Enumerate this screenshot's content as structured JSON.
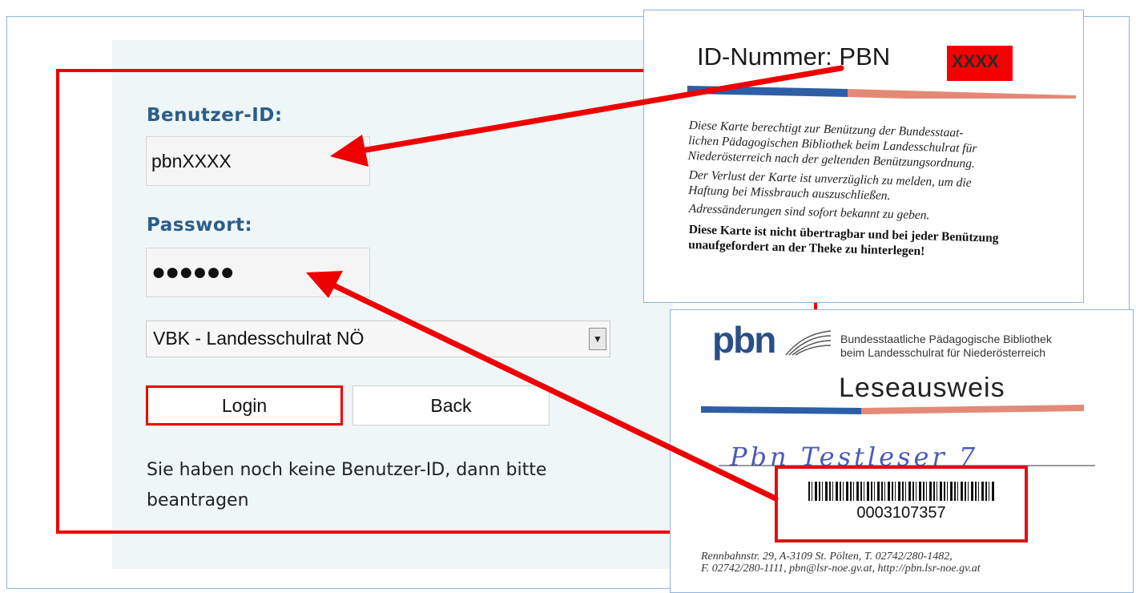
{
  "login": {
    "user_label": "Benutzer-ID:",
    "user_value": "pbnXXXX",
    "password_label": "Passwort:",
    "password_dots": "●●●●●●",
    "library_select": "VBK - Landesschulrat NÖ",
    "login_button": "Login",
    "back_button": "Back",
    "info_line1": "Sie haben noch keine Benutzer-ID, dann bitte",
    "info_line2": "beantragen"
  },
  "card_back": {
    "id_label": "ID-Nummer:  PBN",
    "id_redacted": "XXXX",
    "text1": "Diese Karte berechtigt zur Benützung der Bundesstaat-\nlichen Pädagogischen Bibliothek beim Landesschulrat für\nNiederösterreich nach der geltenden Benützungsordnung.",
    "text2": "Der Verlust der Karte ist unverzüglich zu melden, um die\nHaftung bei Missbrauch auszuschließen.",
    "text3": "Adressänderungen sind sofort bekannt zu geben.",
    "text4": "Diese Karte ist nicht übertragbar und bei jeder Benützung\nunaufgefordert an der Theke zu hinterlegen!"
  },
  "card_front": {
    "logo": "pbn",
    "header": "Bundesstaatliche Pädagogische Bibliothek\nbeim Landesschulrat für Niederösterreich",
    "title": "Leseausweis",
    "handwritten_name": "Pbn  Testleser 7",
    "barcode_number": "0003107357",
    "footer": "Rennbahnstr. 29, A-3109 St. Pölten, T. 02742/280-1482,\nF. 02742/280-1111, pbn@lsr-noe.gv.at, http://pbn.lsr-noe.gv.at"
  },
  "colors": {
    "accent_red": "#ef0000",
    "label_blue": "#2c5d86",
    "frame_blue": "#8fb4dc",
    "panel_bg": "#eef6f8"
  },
  "icons": {
    "select_arrow": "chevron-down-icon"
  }
}
